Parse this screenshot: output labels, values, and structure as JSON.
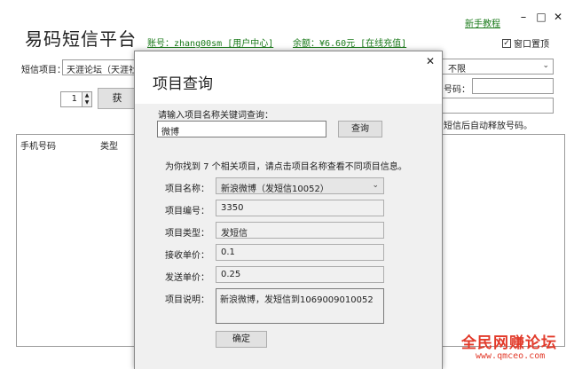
{
  "app": {
    "title": "易码短信平台",
    "account": "账号：zhang00sm [用户中心]",
    "balance": "余额：¥6.60元 [在线充值]",
    "help_link": "新手教程",
    "minimize": "–",
    "maximize": "□",
    "close": "✕",
    "pin_check": "✓",
    "pin_label": "窗口置顶"
  },
  "form": {
    "project_label": "短信项目：",
    "project_value": "天涯论坛（天涯社",
    "region_value": "不限",
    "spin_value": "1",
    "get_button": "获",
    "phone_label": "号码：",
    "phone_value": "",
    "auto_release_text": "短信后自动释放号码。"
  },
  "grid": {
    "columns": [
      "手机号码",
      "类型"
    ]
  },
  "dialog": {
    "title": "项目查询",
    "close": "✕",
    "query_prompt": "请输入项目名称关键词查询：",
    "query_value": "微博",
    "query_button": "查询",
    "result_text": "为你找到 7 个相关项目，请点击项目名称查看不同项目信息。",
    "fields": {
      "name_label": "项目名称：",
      "name_value": "新浪微博（发短信10052）",
      "id_label": "项目编号：",
      "id_value": "3350",
      "type_label": "项目类型：",
      "type_value": "发短信",
      "recv_label": "接收单价：",
      "recv_value": "0.1",
      "send_label": "发送单价：",
      "send_value": "0.25",
      "desc_label": "项目说明：",
      "desc_value": "新浪微博，发短信到1069009010052"
    },
    "ok_button": "确定"
  },
  "watermark": {
    "title": "全民网赚论坛",
    "url": "www.qmceo.com"
  }
}
